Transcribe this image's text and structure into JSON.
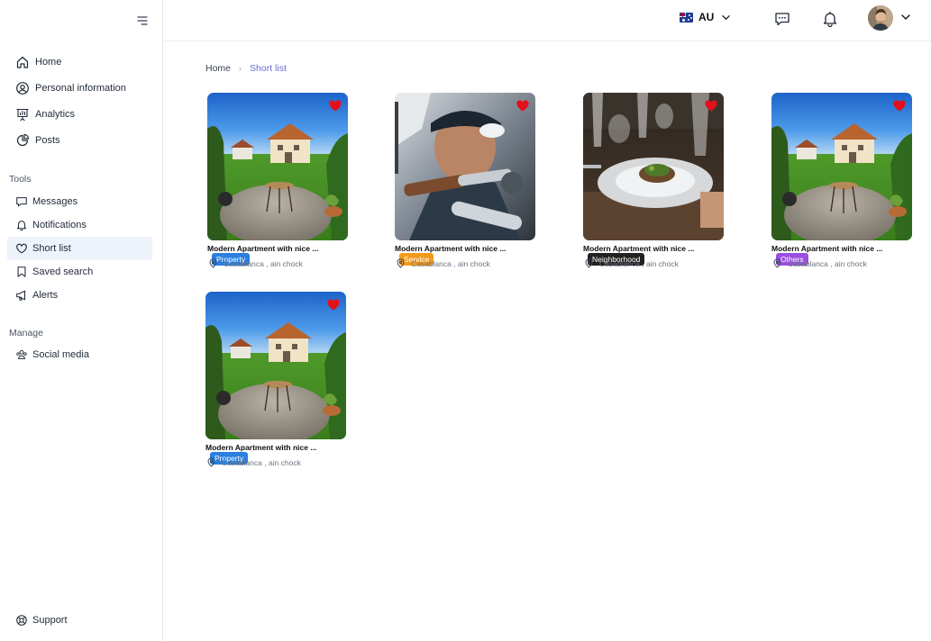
{
  "sidebar": {
    "main_items": [
      {
        "label": "Home",
        "icon": "home-icon"
      },
      {
        "label": "Personal information",
        "icon": "user-circle-icon"
      },
      {
        "label": "Analytics",
        "icon": "presentation-chart-icon"
      },
      {
        "label": "Posts",
        "icon": "pie-chart-icon"
      }
    ],
    "tools_title": "Tools",
    "tools_items": [
      {
        "label": "Messages",
        "icon": "message-icon"
      },
      {
        "label": "Notifications",
        "icon": "bell-icon"
      },
      {
        "label": "Short list",
        "icon": "heart-icon",
        "active": true
      },
      {
        "label": "Saved search",
        "icon": "bookmark-icon"
      },
      {
        "label": "Alerts",
        "icon": "megaphone-icon"
      }
    ],
    "manage_title": "Manage",
    "manage_items": [
      {
        "label": "Social media",
        "icon": "users-icon"
      }
    ],
    "support_label": "Support"
  },
  "header": {
    "language": "AU",
    "language_flag": "australia-flag-icon"
  },
  "breadcrumb": {
    "home": "Home",
    "current": "Short list"
  },
  "colors": {
    "active_bg": "#eef2fb",
    "breadcrumb_active": "#6b6fd4",
    "heart": "#e3101b",
    "badge_property": "#2a7fe0",
    "badge_service": "#f39a1a",
    "badge_neighborhood": "#222222",
    "badge_others": "#9b4fe0"
  },
  "cards": [
    {
      "category": "Property",
      "title": "Modern Apartment  with nice ...",
      "location": "Casablanca , ain chock",
      "image": "house-garden"
    },
    {
      "category": "Service",
      "title": "Modern Apartment  with nice ...",
      "location": "Casablanca , ain chock",
      "image": "welder-man"
    },
    {
      "category": "Neighborhood",
      "title": "Modern Apartment  with nice ...",
      "location": "Casablanca , ain chock",
      "image": "restaurant-dish"
    },
    {
      "category": "Others",
      "title": "Modern Apartment  with nice ...",
      "location": "Casablanca , ain chock",
      "image": "house-garden"
    },
    {
      "category": "Property",
      "title": "Modern Apartment  with nice ...",
      "location": "Casablanca , ain chock",
      "image": "house-garden"
    }
  ]
}
